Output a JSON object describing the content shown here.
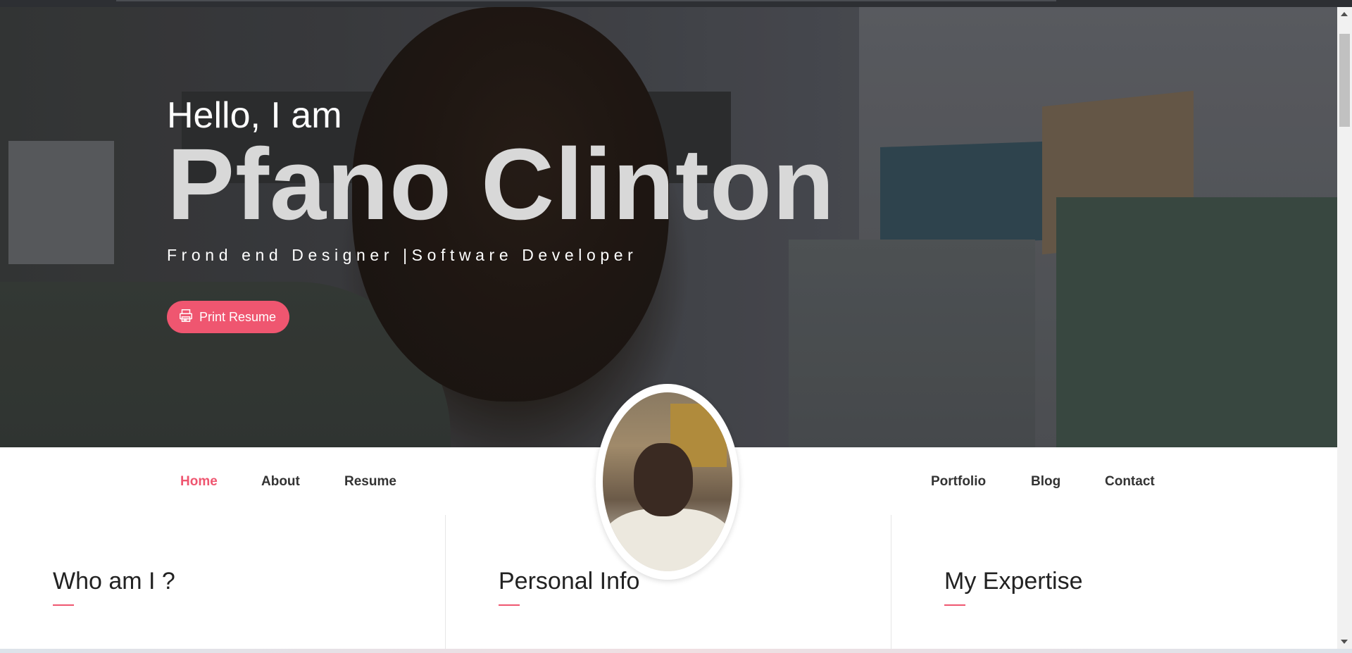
{
  "hero": {
    "greeting": "Hello, I am",
    "name": "Pfano Clinton",
    "tagline": "Frond end Designer |Software Developer",
    "print_button_label": "Print Resume",
    "print_icon": "printer-icon"
  },
  "nav": {
    "left_items": [
      "Home",
      "About",
      "Resume"
    ],
    "right_items": [
      "Portfolio",
      "Blog",
      "Contact"
    ],
    "active": "Home"
  },
  "sections": {
    "titles": [
      "Who am I ?",
      "Personal Info",
      "My Expertise"
    ]
  },
  "colors": {
    "accent": "#ef5670",
    "nav_text": "#333333"
  }
}
